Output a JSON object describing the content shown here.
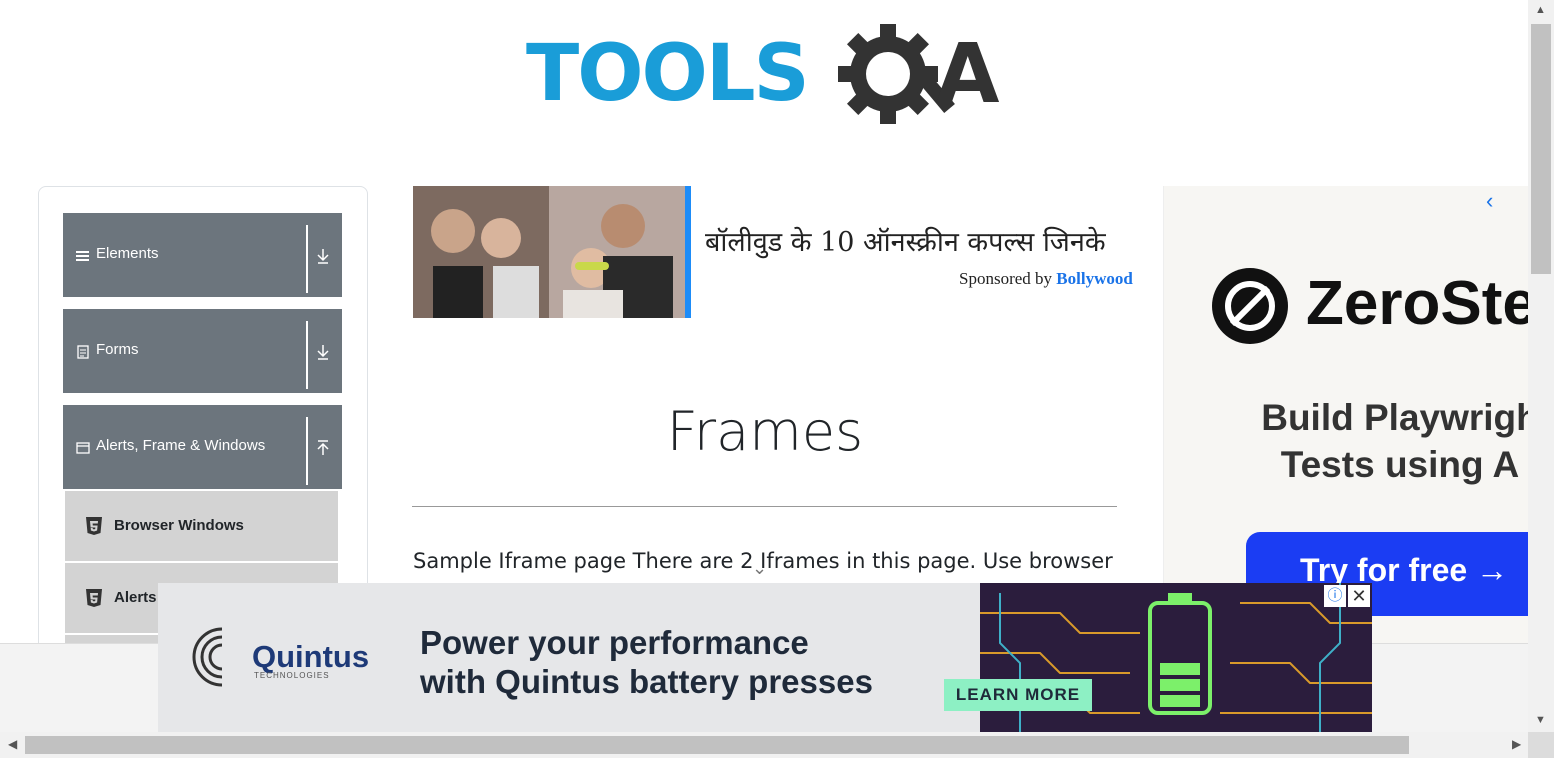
{
  "logo": {
    "text": "TOOLS",
    "text_tail": "A"
  },
  "sidebar": {
    "groups": [
      {
        "label": "Elements",
        "icon": "menu-icon",
        "arrow": "download-arrow-icon"
      },
      {
        "label": "Forms",
        "icon": "document-icon",
        "arrow": "download-arrow-icon"
      },
      {
        "label": "Alerts, Frame & Windows",
        "icon": "window-icon",
        "arrow": "upload-arrow-icon"
      }
    ],
    "sub_items": [
      {
        "label": "Browser Windows",
        "icon": "html5-icon"
      },
      {
        "label": "Alerts",
        "icon": "html5-icon"
      }
    ]
  },
  "ad_top": {
    "headline": "बॉलीवुड के 10 ऑनस्क्रीन कपल्स जिनके",
    "sponsor_prefix": "Sponsored by",
    "sponsor_name": "Bollywood"
  },
  "main": {
    "heading": "Frames",
    "body_text": "Sample Iframe page There are 2 Iframes in this page. Use browser"
  },
  "ad_right": {
    "chevron": "‹",
    "brand": "ZeroSte",
    "headline_line1": "Build Playwrigh",
    "headline_line2": "Tests using A",
    "button": "Try for free →"
  },
  "ad_bottom": {
    "brand": "Quintus",
    "brand_sub": "TECHNOLOGIES",
    "text_line1": "Power your performance",
    "text_line2": "with Quintus battery presses",
    "cta": "LEARN MORE",
    "info": "ⓘ",
    "close": "✕"
  },
  "colors": {
    "logo_blue": "#1a9dd8",
    "sidebar_header": "#6c757d",
    "sub_item": "#d3d3d3",
    "zs_button": "#1b3df3",
    "learn_more": "#8df0c4"
  }
}
